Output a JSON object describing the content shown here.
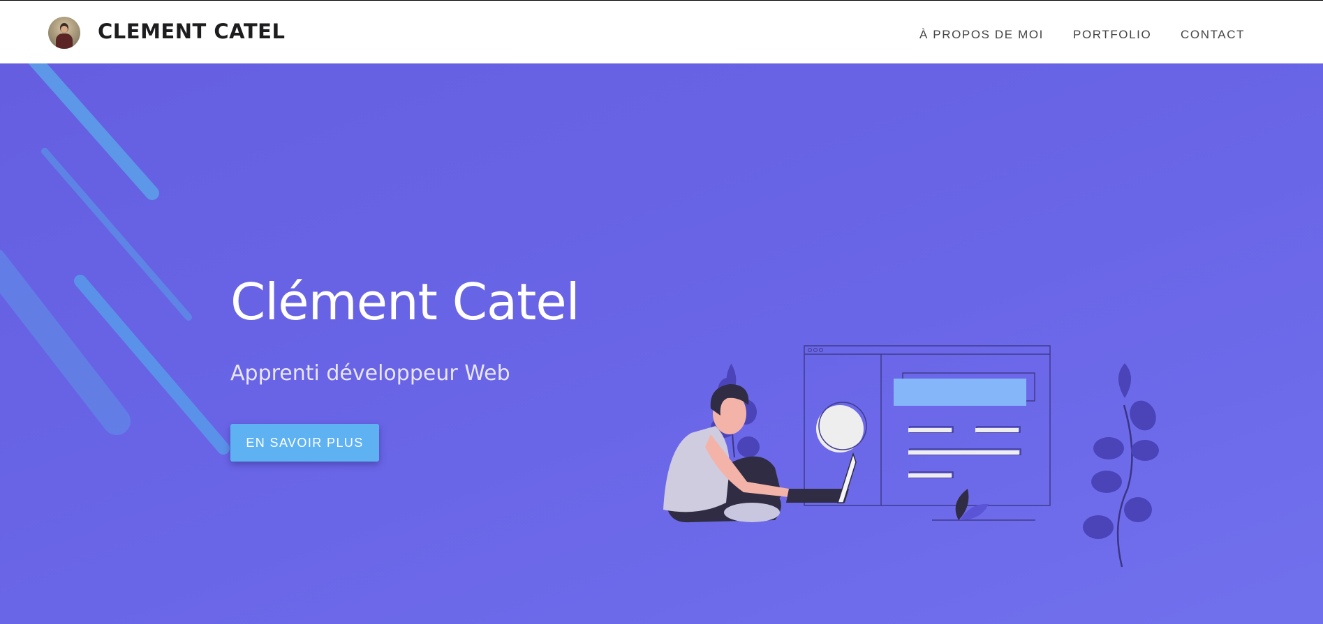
{
  "header": {
    "brand": "CLEMENT CATEL",
    "nav": [
      {
        "label": "À PROPOS DE MOI"
      },
      {
        "label": "PORTFOLIO"
      },
      {
        "label": "CONTACT"
      }
    ]
  },
  "hero": {
    "title": "Clément Catel",
    "subtitle": "Apprenti développeur Web",
    "cta_label": "EN SAVOIR PLUS"
  },
  "colors": {
    "hero_background": "#6a64e6",
    "button": "#5eb2f2",
    "header_background": "#ffffff"
  },
  "icons": {
    "avatar": "profile-photo",
    "illustration": "developer-with-laptop-illustration"
  }
}
